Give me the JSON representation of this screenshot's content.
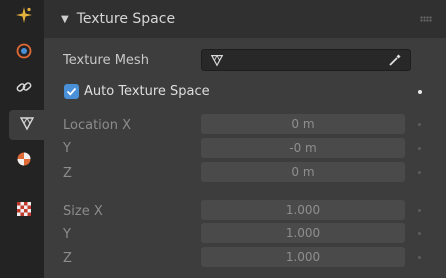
{
  "panel": {
    "title": "Texture Space",
    "texture_mesh_label": "Texture Mesh",
    "auto_texture_space_label": "Auto Texture Space",
    "auto_texture_space_checked": true,
    "location": {
      "x_label": "Location X",
      "y_label": "Y",
      "z_label": "Z",
      "x_value": "0 m",
      "y_value": "-0 m",
      "z_value": "0 m"
    },
    "size": {
      "x_label": "Size X",
      "y_label": "Y",
      "z_label": "Z",
      "x_value": "1.000",
      "y_value": "1.000",
      "z_value": "1.000"
    }
  },
  "tabs": [
    {
      "icon": "sparkle-icon"
    },
    {
      "icon": "physics-icon"
    },
    {
      "icon": "constraint-icon"
    },
    {
      "icon": "mesh-data-icon"
    },
    {
      "icon": "material-icon"
    },
    {
      "icon": "texture-icon"
    }
  ],
  "colors": {
    "accent": "#4a90d9",
    "panel_bg": "#3d3d3d",
    "header_bg": "#303030",
    "tab_strip_bg": "#232323"
  }
}
